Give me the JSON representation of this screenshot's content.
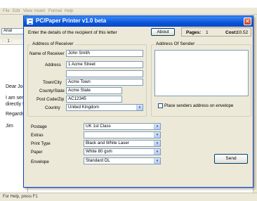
{
  "background_app": {
    "menu": [
      "File",
      "Edit",
      "View",
      "Insert",
      "Format",
      "Help"
    ],
    "font_name": "Arial",
    "document_lines": [
      "Dear Joh",
      "I am sen",
      "directly f",
      "Regards,",
      "Jim"
    ],
    "status_text": "For Help, press F1"
  },
  "dialog": {
    "title": "PC/Paper Printer v1.0 beta",
    "close_glyph": "✕",
    "instruction": "Enter the details of the recipient of this letter",
    "about_label": "About",
    "pages_label": "Pages:",
    "pages_value": "1",
    "cost_label": "Cost:",
    "cost_value": "£0.52"
  },
  "receiver": {
    "group_title": "Address of Receiver",
    "name_label": "Name of Receiver",
    "name_value": "John Smith",
    "address_label": "Address",
    "address_line1": "1 Acme Street",
    "address_line2": "",
    "town_label": "Town/City",
    "town_value": "Acme Town",
    "county_label": "County/State",
    "county_value": "Acme State",
    "postcode_label": "Post Code/Zip",
    "postcode_value": "AC12345",
    "country_label": "Country",
    "country_value": "United Kingdom"
  },
  "sender": {
    "group_title": "Address Of Sender",
    "address_value": "",
    "place_checkbox_label": "Place senders address on envelope"
  },
  "options": {
    "postage_label": "Postage",
    "postage_value": "UK 1st Class",
    "extras_label": "Extras",
    "extras_value": "",
    "print_type_label": "Print Type",
    "print_type_value": "Black and White Laser",
    "paper_label": "Paper",
    "paper_value": "White 80 gsm",
    "envelope_label": "Envelope",
    "envelope_value": "Standard DL"
  },
  "send_label": "Send",
  "icons": {
    "dropdown": "▾",
    "close": "close-icon"
  },
  "colors": {
    "titlebar": "#0b56d9",
    "dialog_bg": "#ece9d8",
    "field_border": "#7f9db9"
  }
}
